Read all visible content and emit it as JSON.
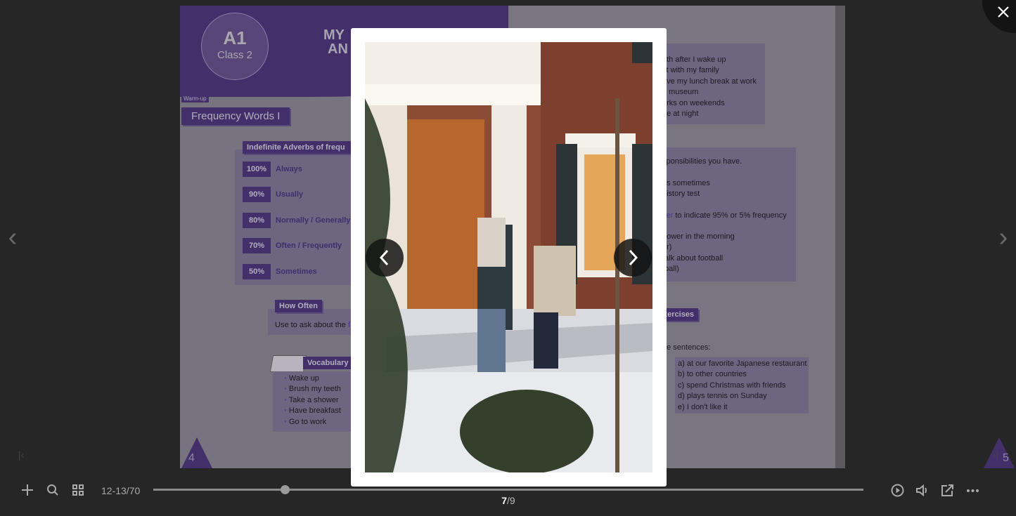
{
  "book": {
    "left_page": {
      "badge_level": "A1",
      "badge_class": "Class 2",
      "title_line1": "MY",
      "title_line2": "AN",
      "warmup_tag": "Warm-up",
      "section_title": "Frequency Words I",
      "adverbs_header": "Indefinite Adverbs of frequ",
      "adverbs": [
        {
          "pct": "100%",
          "label": "Always"
        },
        {
          "pct": "90%",
          "label": "Usually"
        },
        {
          "pct": "80%",
          "label": "Normally / Generally"
        },
        {
          "pct": "70%",
          "label": "Often / Frequently"
        },
        {
          "pct": "50%",
          "label": "Sometimes"
        }
      ],
      "how_often_label": "How Often",
      "how_often_text": "Use to ask about the ",
      "how_often_highlight": "f",
      "vocabulary_label": "Vocabulary",
      "vocabulary": [
        "Wake up",
        "Brush my teeth",
        "Take a shower",
        "Have breakfast",
        "Go to work"
      ],
      "page_number": "4"
    },
    "right_page": {
      "box1": [
        "eth after I wake up",
        "st with my family",
        "ave my lunch break at work",
        "e museum",
        "orks on weekends",
        "ee at night"
      ],
      "box2_line1": "sponsibilities you have.",
      "box2_lines_a": [
        "ds sometimes",
        "history test"
      ],
      "box2_highlight": "ver",
      "box2_rest": " to indicate 95% or 5% frequency",
      "box2_lines_b": [
        "hower in the morning",
        "er)",
        "talk about football",
        "tball)"
      ],
      "exercises_label": "xercises",
      "exercises_prompt": "he sentences:",
      "answers": [
        "a) at our favorite Japanese restaurant",
        "b) to other countries",
        "c) spend Christmas with friends",
        "d) plays tennis on Sunday",
        "e) I don't like it"
      ],
      "page_number": "5"
    }
  },
  "lightbox": {
    "current": "7",
    "total": "/9",
    "icons": {
      "prev": "chevron-left-icon",
      "next": "chevron-right-icon",
      "close": "close-icon"
    }
  },
  "toolbar": {
    "page_indicator": "12-13/70",
    "progress_fraction": 0.185,
    "icons": [
      "plus-icon",
      "search-icon",
      "grid-icon",
      "play-icon",
      "volume-icon",
      "share-icon",
      "more-icon"
    ]
  },
  "colors": {
    "accent": "#43306b",
    "background": "#262626"
  }
}
